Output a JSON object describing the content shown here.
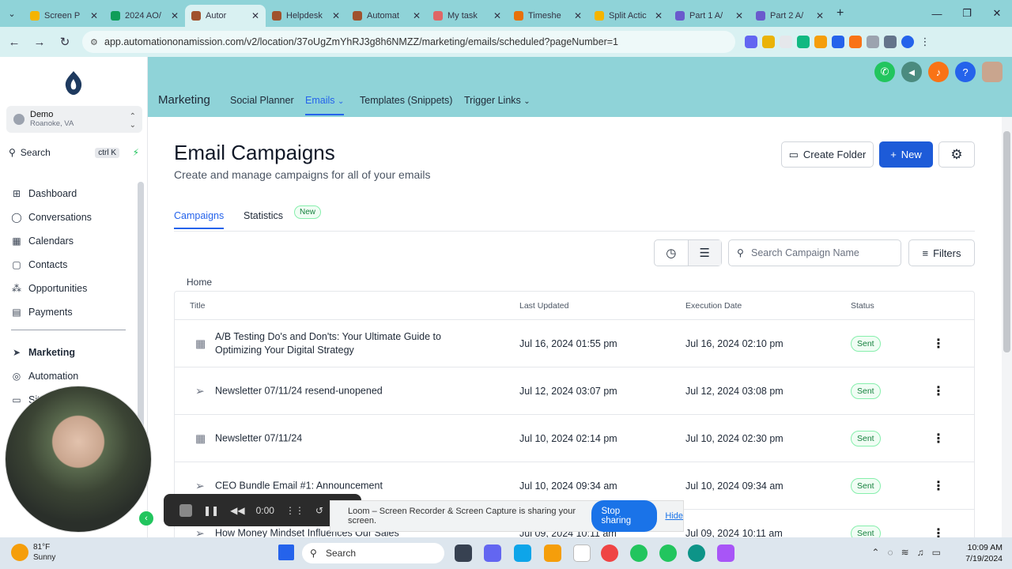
{
  "browser": {
    "tabs": [
      {
        "label": "Screen P",
        "color": "#f4b400"
      },
      {
        "label": "2024 AO/",
        "color": "#0f9d58"
      },
      {
        "label": "Autor",
        "color": "#a0522d",
        "active": true
      },
      {
        "label": "Helpdesk",
        "color": "#a0522d"
      },
      {
        "label": "Automat",
        "color": "#a0522d"
      },
      {
        "label": "My task",
        "color": "#e06666"
      },
      {
        "label": "Timeshe",
        "color": "#e8710a"
      },
      {
        "label": "Split Actic",
        "color": "#f4b400"
      },
      {
        "label": "Part 1 A/",
        "color": "#6a5acd"
      },
      {
        "label": "Part 2 A/",
        "color": "#6a5acd"
      }
    ],
    "url": "app.automationonamission.com/v2/location/37oUgZmYhRJ3g8h6NMZZ/marketing/emails/scheduled?pageNumber=1"
  },
  "sidebar": {
    "location_name": "Demo",
    "location_city": "Roanoke, VA",
    "search_label": "Search",
    "search_shortcut": "ctrl K",
    "items": [
      {
        "label": "Dashboard",
        "icon": "⊞"
      },
      {
        "label": "Conversations",
        "icon": "◯"
      },
      {
        "label": "Calendars",
        "icon": "▦"
      },
      {
        "label": "Contacts",
        "icon": "▢"
      },
      {
        "label": "Opportunities",
        "icon": "⁂"
      },
      {
        "label": "Payments",
        "icon": "▤"
      }
    ],
    "items2": [
      {
        "label": "Marketing",
        "icon": "➤",
        "active": true
      },
      {
        "label": "Automation",
        "icon": "◎"
      },
      {
        "label": "Sit",
        "icon": "▭"
      }
    ]
  },
  "topnav": {
    "brand": "Marketing",
    "items": [
      "Social Planner",
      "Emails",
      "Templates (Snippets)",
      "Trigger Links"
    ]
  },
  "page": {
    "title": "Email Campaigns",
    "subtitle": "Create and manage campaigns for all of your emails",
    "create_folder": "Create Folder",
    "new_button": "New",
    "tab_campaigns": "Campaigns",
    "tab_statistics": "Statistics",
    "new_badge": "New",
    "search_placeholder": "Search Campaign Name",
    "filters_label": "Filters",
    "breadcrumb": "Home"
  },
  "table": {
    "headers": [
      "Title",
      "Last Updated",
      "Execution Date",
      "Status"
    ],
    "rows": [
      {
        "icon": "calendar",
        "title": "A/B Testing Do's and Don'ts: Your Ultimate Guide to Optimizing Your Digital Strategy",
        "last_updated": "Jul 16, 2024 01:55 pm",
        "execution": "Jul 16, 2024 02:10 pm",
        "status": "Sent"
      },
      {
        "icon": "send",
        "title": "Newsletter 07/11/24 resend-unopened",
        "last_updated": "Jul 12, 2024 03:07 pm",
        "execution": "Jul 12, 2024 03:08 pm",
        "status": "Sent"
      },
      {
        "icon": "calendar",
        "title": "Newsletter 07/11/24",
        "last_updated": "Jul 10, 2024 02:14 pm",
        "execution": "Jul 10, 2024 02:30 pm",
        "status": "Sent"
      },
      {
        "icon": "send",
        "title": "CEO Bundle Email #1: Announcement",
        "last_updated": "Jul 10, 2024 09:34 am",
        "execution": "Jul 10, 2024 09:34 am",
        "status": "Sent"
      },
      {
        "icon": "send",
        "title": "How Money Mindset Influences Our Sales",
        "last_updated": "Jul 09, 2024 10:11 am",
        "execution": "Jul 09, 2024 10:11 am",
        "status": "Sent"
      }
    ]
  },
  "loom": {
    "timer": "0:00",
    "share_text": "Loom – Screen Recorder & Screen Capture is sharing your screen.",
    "stop": "Stop sharing",
    "hide": "Hide"
  },
  "taskbar": {
    "temp": "81°F",
    "weather": "Sunny",
    "search": "Search",
    "time": "10:09 AM",
    "date": "7/19/2024"
  },
  "colors": {
    "accent": "#2563eb",
    "header": "#8fd3d8",
    "sent": "#15803d"
  }
}
